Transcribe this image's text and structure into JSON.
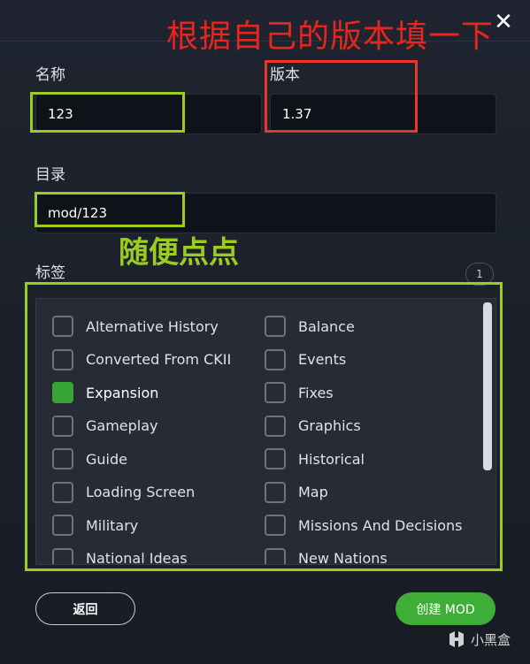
{
  "annotations": {
    "title_red": "根据自己的版本填一下",
    "tags_green": "随便点点"
  },
  "header": {
    "close_glyph": "✕"
  },
  "form": {
    "name_label": "名称",
    "name_value": "123",
    "version_label": "版本",
    "version_value": "1.37",
    "dir_label": "目录",
    "dir_value": "mod/123",
    "tags_label": "标签",
    "tags_selected_count": "1"
  },
  "tags": {
    "left": [
      {
        "label": "Alternative History",
        "checked": false
      },
      {
        "label": "Converted From CKII",
        "checked": false
      },
      {
        "label": "Expansion",
        "checked": true
      },
      {
        "label": "Gameplay",
        "checked": false
      },
      {
        "label": "Guide",
        "checked": false
      },
      {
        "label": "Loading Screen",
        "checked": false
      },
      {
        "label": "Military",
        "checked": false
      },
      {
        "label": "National Ideas",
        "checked": false
      }
    ],
    "right": [
      {
        "label": "Balance",
        "checked": false
      },
      {
        "label": "Events",
        "checked": false
      },
      {
        "label": "Fixes",
        "checked": false
      },
      {
        "label": "Graphics",
        "checked": false
      },
      {
        "label": "Historical",
        "checked": false
      },
      {
        "label": "Map",
        "checked": false
      },
      {
        "label": "Missions And Decisions",
        "checked": false
      },
      {
        "label": "New Nations",
        "checked": false
      }
    ]
  },
  "buttons": {
    "back_label": "返回",
    "create_label": "创建 MOD"
  },
  "watermark": {
    "text": "小黑盒"
  },
  "colors": {
    "accent_green": "#3fae36",
    "annotation_red": "#e8261c",
    "annotation_green": "#9acd1f"
  }
}
